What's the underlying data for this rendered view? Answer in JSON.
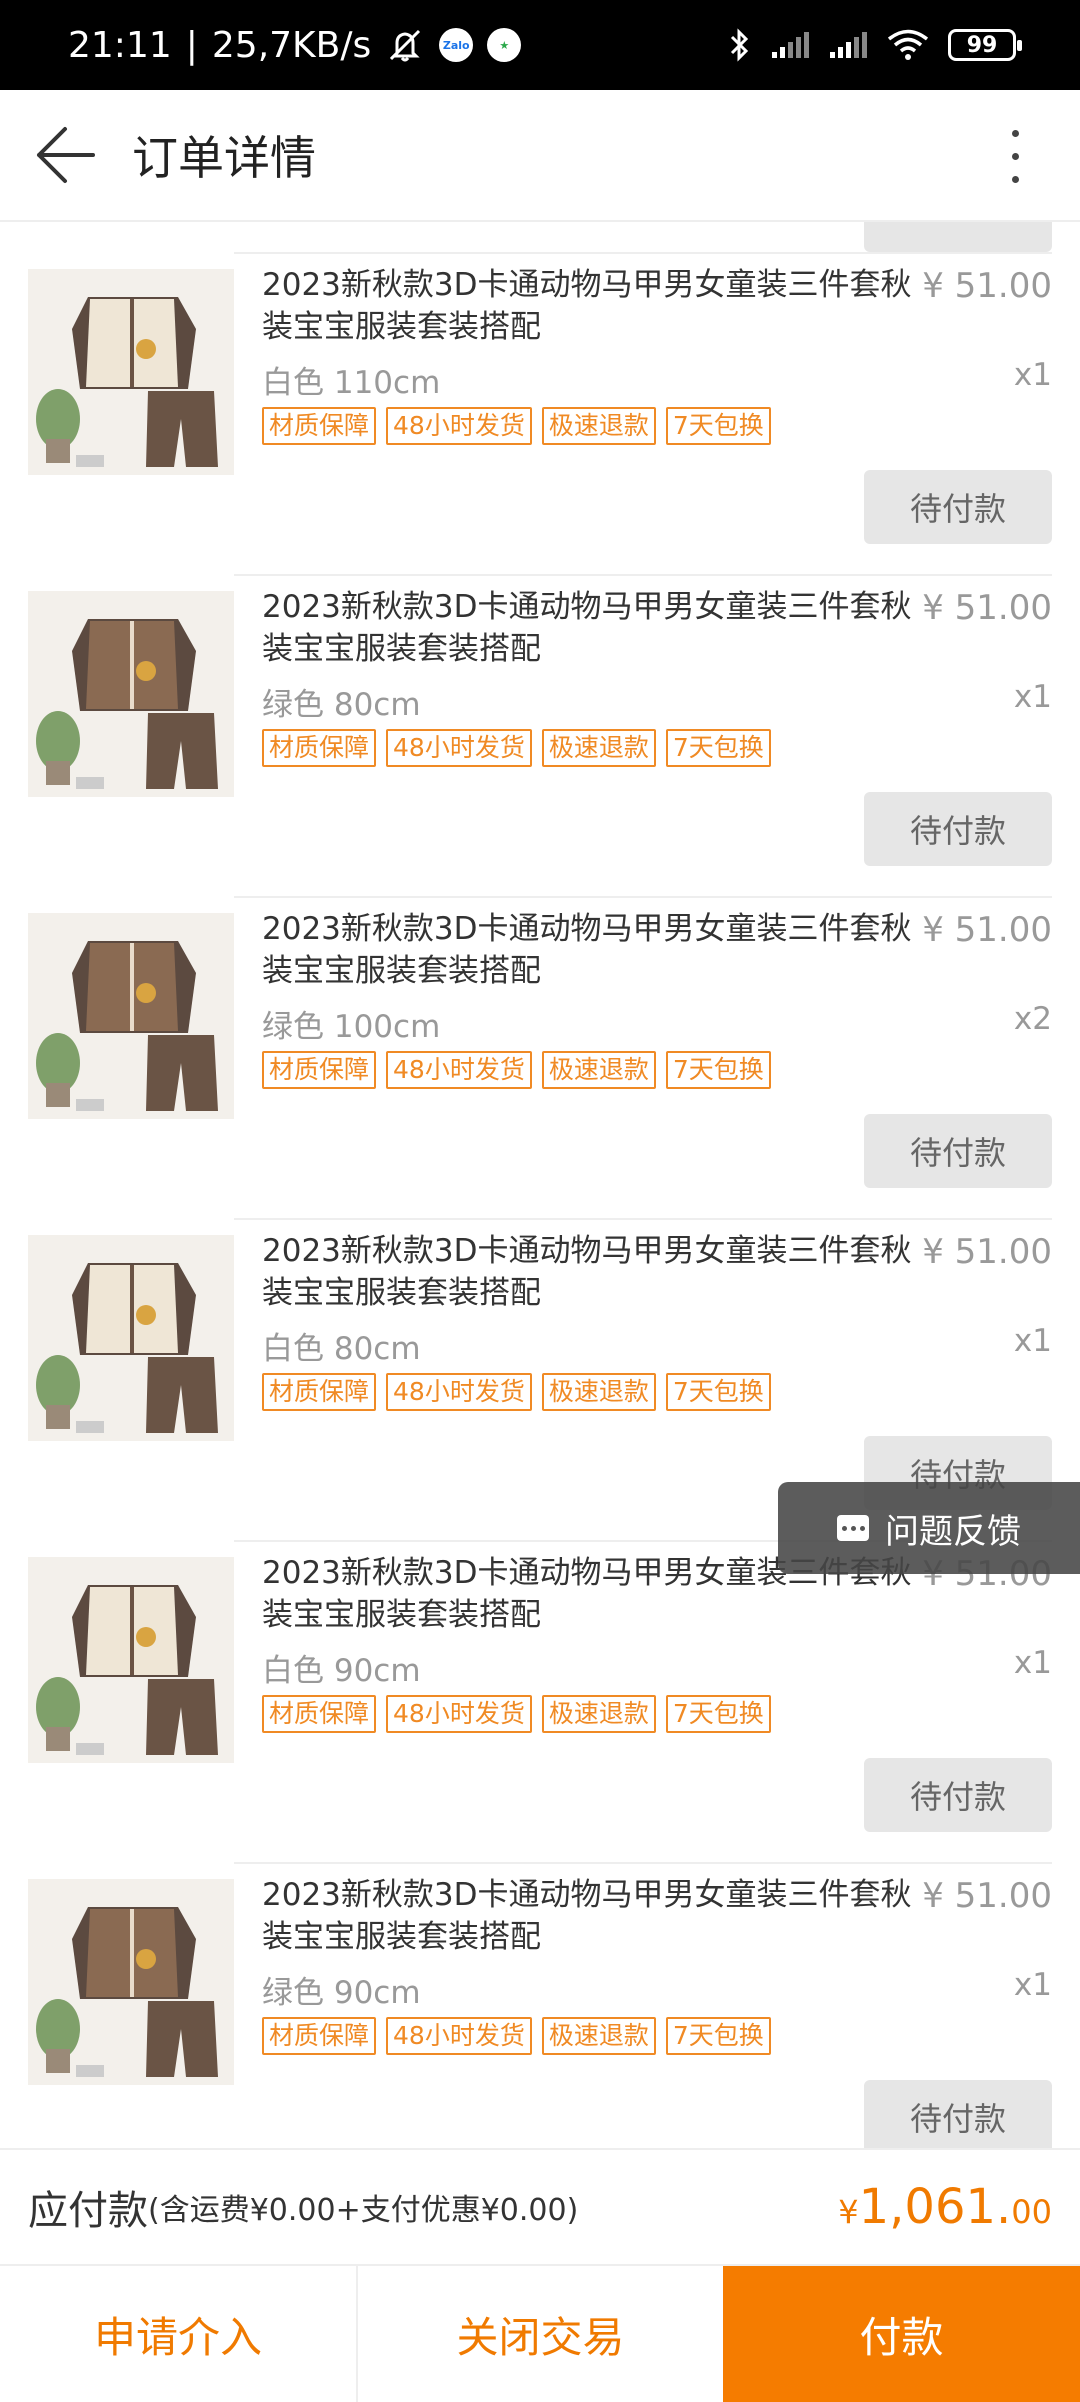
{
  "status_bar": {
    "time": "21:11",
    "speed": "25,7KB/s",
    "battery": "99",
    "icons": [
      "mute-icon",
      "zalo-icon",
      "app-icon",
      "bluetooth-icon",
      "signal-icon",
      "signal-icon",
      "wifi-icon",
      "battery-icon"
    ]
  },
  "header": {
    "title": "订单详情",
    "back_icon": "arrow-left-icon",
    "more_icon": "more-vertical-icon"
  },
  "items": [
    {
      "title": "2023新秋款3D卡通动物马甲男女童装三件套秋装宝宝服装套装搭配",
      "price": "¥ 51.00",
      "spec": "白色 110cm",
      "qty": "x1",
      "status": "待付款",
      "color": "white"
    },
    {
      "title": "2023新秋款3D卡通动物马甲男女童装三件套秋装宝宝服装套装搭配",
      "price": "¥ 51.00",
      "spec": "绿色 80cm",
      "qty": "x1",
      "status": "待付款",
      "color": "brown"
    },
    {
      "title": "2023新秋款3D卡通动物马甲男女童装三件套秋装宝宝服装套装搭配",
      "price": "¥ 51.00",
      "spec": "绿色 100cm",
      "qty": "x2",
      "status": "待付款",
      "color": "brown"
    },
    {
      "title": "2023新秋款3D卡通动物马甲男女童装三件套秋装宝宝服装套装搭配",
      "price": "¥ 51.00",
      "spec": "白色 80cm",
      "qty": "x1",
      "status": "待付款",
      "color": "white"
    },
    {
      "title": "2023新秋款3D卡通动物马甲男女童装三件套秋装宝宝服装套装搭配",
      "price": "¥ 51.00",
      "spec": "白色 90cm",
      "qty": "x1",
      "status": "待付款",
      "color": "white"
    },
    {
      "title": "2023新秋款3D卡通动物马甲男女童装三件套秋装宝宝服装套装搭配",
      "price": "¥ 51.00",
      "spec": "绿色 90cm",
      "qty": "x1",
      "status": "待付款",
      "color": "brown"
    }
  ],
  "tags": [
    "材质保障",
    "48小时发货",
    "极速退款",
    "7天包换"
  ],
  "feedback": {
    "label": "问题反馈",
    "icon": "chat-icon"
  },
  "summary": {
    "label": "应付款",
    "detail": "(含运费¥0.00+支付优惠¥0.00)",
    "currency": "¥",
    "amount_int": "1,061.",
    "amount_dec": "00"
  },
  "actions": {
    "intervene": "申请介入",
    "close": "关闭交易",
    "pay": "付款"
  },
  "colors": {
    "accent": "#f57c00",
    "tag": "#f08a24",
    "status_bg": "#e6e6e6"
  }
}
